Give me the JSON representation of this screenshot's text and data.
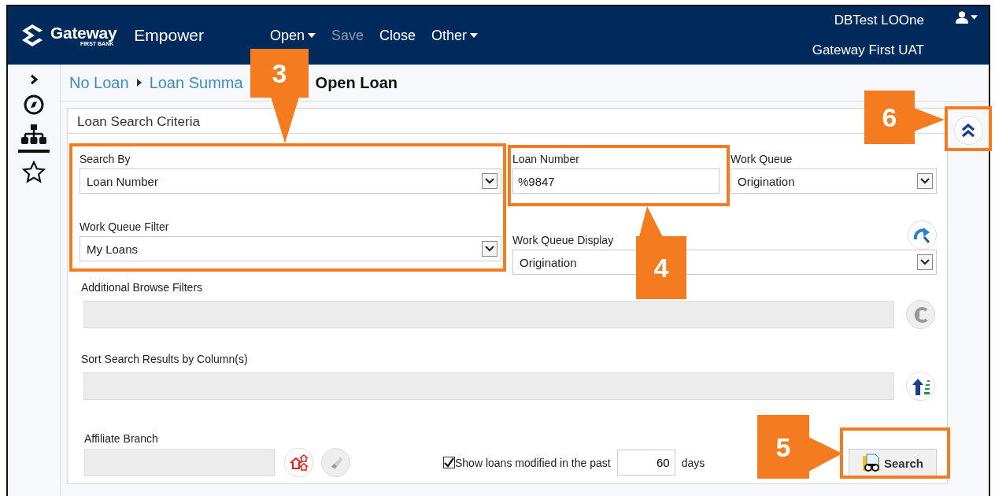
{
  "header": {
    "logo": {
      "name": "Gateway",
      "tagline": "FIRST BANK"
    },
    "app_name": "Empower",
    "menu": [
      {
        "label": "Open",
        "dropdown": true,
        "disabled": false
      },
      {
        "label": "Save",
        "dropdown": false,
        "disabled": true
      },
      {
        "label": "Close",
        "dropdown": false,
        "disabled": false
      },
      {
        "label": "Other",
        "dropdown": true,
        "disabled": false
      }
    ],
    "user": "DBTest LOOne",
    "environment": "Gateway First UAT"
  },
  "sidebar": {
    "items": [
      {
        "selected": false
      },
      {
        "selected": true
      },
      {
        "selected": false
      }
    ]
  },
  "breadcrumb": [
    {
      "label": "No Loan",
      "kind": "link"
    },
    {
      "label": "Loan Summa",
      "kind": "link"
    },
    {
      "label": "Open Loan",
      "kind": "current"
    }
  ],
  "panel": {
    "title": "Loan Search Criteria",
    "fields": [
      {
        "label": "Search By",
        "kind": "select",
        "value": "Loan Number"
      },
      {
        "label": "Loan Number",
        "kind": "text",
        "value": "%9847"
      },
      {
        "label": "Work Queue",
        "kind": "select",
        "value": "Origination"
      },
      {
        "label": "Work Queue Filter",
        "kind": "select",
        "value": "My Loans"
      },
      {
        "label": "Work Queue Display",
        "kind": "select",
        "value": "Origination"
      }
    ],
    "browse_filters": {
      "label": "Additional Browse Filters"
    },
    "sort_columns": {
      "label": "Sort Search Results by Column(s)"
    },
    "affiliate_branch": {
      "label": "Affiliate Branch"
    },
    "recent_filter": {
      "label": "Show loans modified in the past",
      "checked": true,
      "value": "60",
      "unit": "days"
    },
    "search_button": {
      "label": "Search"
    }
  },
  "callouts": [
    {
      "label": "3"
    },
    {
      "label": "6"
    },
    {
      "label": "4"
    },
    {
      "label": "5"
    }
  ]
}
